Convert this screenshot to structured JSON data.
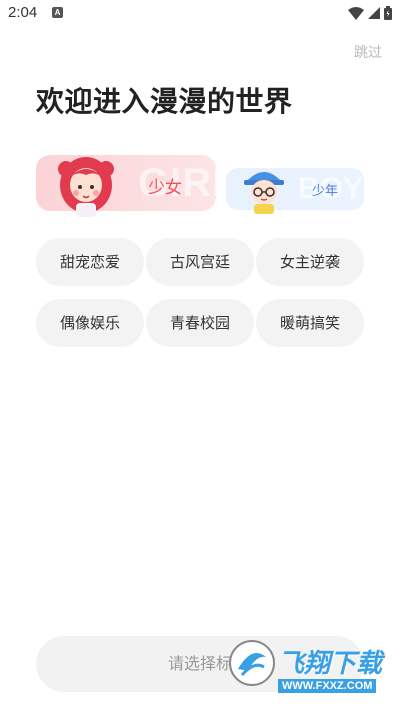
{
  "status": {
    "time": "2:04",
    "notif_letter": "A"
  },
  "header": {
    "skip": "跳过",
    "title": "欢迎进入漫漫的世界"
  },
  "gender": {
    "girl": {
      "label": "少女",
      "watermark": "GIRL"
    },
    "boy": {
      "label": "少年",
      "watermark": "BOY"
    }
  },
  "tags": [
    "甜宠恋爱",
    "古风宫廷",
    "女主逆袭",
    "偶像娱乐",
    "青春校园",
    "暖萌搞笑"
  ],
  "bottom": {
    "label": "请选择标"
  },
  "watermark": {
    "brand": "飞翔下载",
    "url": "WWW.FXXZ.COM"
  }
}
